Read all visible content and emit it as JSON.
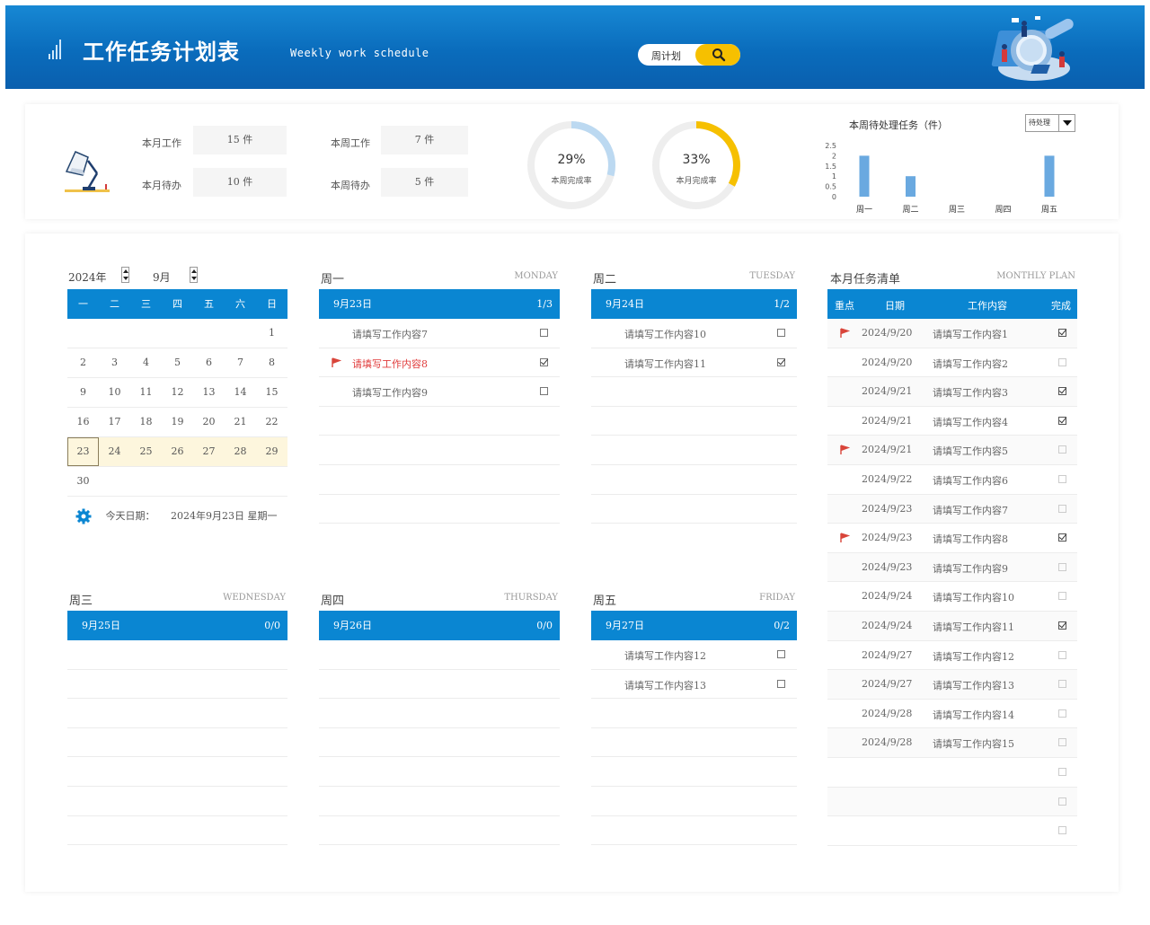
{
  "header": {
    "title": "工作任务计划表",
    "subtitle": "Weekly work schedule",
    "search_value": "周计划"
  },
  "stats": {
    "month_work_label": "本月工作",
    "month_work_value": "15 件",
    "month_todo_label": "本月待办",
    "month_todo_value": "10 件",
    "week_work_label": "本周工作",
    "week_work_value": "7 件",
    "week_todo_label": "本周待办",
    "week_todo_value": "5 件",
    "week_rate_pct": "29%",
    "week_rate_label": "本周完成率",
    "week_rate_fraction": 0.29,
    "month_rate_pct": "33%",
    "month_rate_label": "本月完成率",
    "month_rate_fraction": 0.33
  },
  "chart_data": {
    "type": "bar",
    "title": "本周待处理任务（件）",
    "filter_value": "待处理",
    "categories": [
      "周一",
      "周二",
      "周三",
      "周四",
      "周五"
    ],
    "values": [
      2,
      1,
      0,
      0,
      2
    ],
    "yticks": [
      "2.5",
      "2",
      "1.5",
      "1",
      "0.5",
      "0"
    ],
    "ylim": [
      0,
      2.5
    ],
    "color": "#6aa9e0"
  },
  "calendar": {
    "year": "2024年",
    "month": "9月",
    "weekdays": [
      "一",
      "二",
      "三",
      "四",
      "五",
      "六",
      "日"
    ],
    "weeks": [
      [
        "",
        "",
        "",
        "",
        "",
        "",
        "1"
      ],
      [
        "2",
        "3",
        "4",
        "5",
        "6",
        "7",
        "8"
      ],
      [
        "9",
        "10",
        "11",
        "12",
        "13",
        "14",
        "15"
      ],
      [
        "16",
        "17",
        "18",
        "19",
        "20",
        "21",
        "22"
      ],
      [
        "23",
        "24",
        "25",
        "26",
        "27",
        "28",
        "29"
      ],
      [
        "30",
        "",
        "",
        "",
        "",
        "",
        ""
      ]
    ],
    "current_week_index": 4,
    "today_day": "23",
    "today_label": "今天日期：",
    "today_value": "2024年9月23日  星期一"
  },
  "days": {
    "mon": {
      "title": "周一",
      "en": "MONDAY",
      "date": "9月23日",
      "count": "1/3",
      "tasks": [
        {
          "text": "请填写工作内容7",
          "done": false,
          "flag": false
        },
        {
          "text": "请填写工作内容8",
          "done": true,
          "flag": true
        },
        {
          "text": "请填写工作内容9",
          "done": false,
          "flag": false
        }
      ]
    },
    "tue": {
      "title": "周二",
      "en": "TUESDAY",
      "date": "9月24日",
      "count": "1/2",
      "tasks": [
        {
          "text": "请填写工作内容10",
          "done": false,
          "flag": false
        },
        {
          "text": "请填写工作内容11",
          "done": true,
          "flag": false
        }
      ]
    },
    "wed": {
      "title": "周三",
      "en": "WEDNESDAY",
      "date": "9月25日",
      "count": "0/0",
      "tasks": []
    },
    "thu": {
      "title": "周四",
      "en": "THURSDAY",
      "date": "9月26日",
      "count": "0/0",
      "tasks": []
    },
    "fri": {
      "title": "周五",
      "en": "FRIDAY",
      "date": "9月27日",
      "count": "0/2",
      "tasks": [
        {
          "text": "请填写工作内容12",
          "done": false,
          "flag": false
        },
        {
          "text": "请填写工作内容13",
          "done": false,
          "flag": false
        }
      ]
    }
  },
  "monthly": {
    "title": "本月任务清单",
    "en": "MONTHLY PLAN",
    "headers": [
      "重点",
      "日期",
      "工作内容",
      "完成"
    ],
    "items": [
      {
        "flag": true,
        "date": "2024/9/20",
        "text": "请填写工作内容1",
        "done": true
      },
      {
        "flag": false,
        "date": "2024/9/20",
        "text": "请填写工作内容2",
        "done": false
      },
      {
        "flag": false,
        "date": "2024/9/21",
        "text": "请填写工作内容3",
        "done": true
      },
      {
        "flag": false,
        "date": "2024/9/21",
        "text": "请填写工作内容4",
        "done": true
      },
      {
        "flag": true,
        "date": "2024/9/21",
        "text": "请填写工作内容5",
        "done": false
      },
      {
        "flag": false,
        "date": "2024/9/22",
        "text": "请填写工作内容6",
        "done": false
      },
      {
        "flag": false,
        "date": "2024/9/23",
        "text": "请填写工作内容7",
        "done": false
      },
      {
        "flag": true,
        "date": "2024/9/23",
        "text": "请填写工作内容8",
        "done": true
      },
      {
        "flag": false,
        "date": "2024/9/23",
        "text": "请填写工作内容9",
        "done": false
      },
      {
        "flag": false,
        "date": "2024/9/24",
        "text": "请填写工作内容10",
        "done": false
      },
      {
        "flag": false,
        "date": "2024/9/24",
        "text": "请填写工作内容11",
        "done": true
      },
      {
        "flag": false,
        "date": "2024/9/27",
        "text": "请填写工作内容12",
        "done": false
      },
      {
        "flag": false,
        "date": "2024/9/27",
        "text": "请填写工作内容13",
        "done": false
      },
      {
        "flag": false,
        "date": "2024/9/28",
        "text": "请填写工作内容14",
        "done": false
      },
      {
        "flag": false,
        "date": "2024/9/28",
        "text": "请填写工作内容15",
        "done": false
      },
      {
        "flag": false,
        "date": "",
        "text": "",
        "done": false
      },
      {
        "flag": false,
        "date": "",
        "text": "",
        "done": false
      },
      {
        "flag": false,
        "date": "",
        "text": "",
        "done": false
      }
    ]
  },
  "colors": {
    "primary": "#0a86d2",
    "accent_yellow": "#f6c000",
    "week_ring": "#bcd9f1",
    "month_ring": "#f6c000",
    "ring_track": "#eeeeee",
    "flag": "#d9453a"
  }
}
